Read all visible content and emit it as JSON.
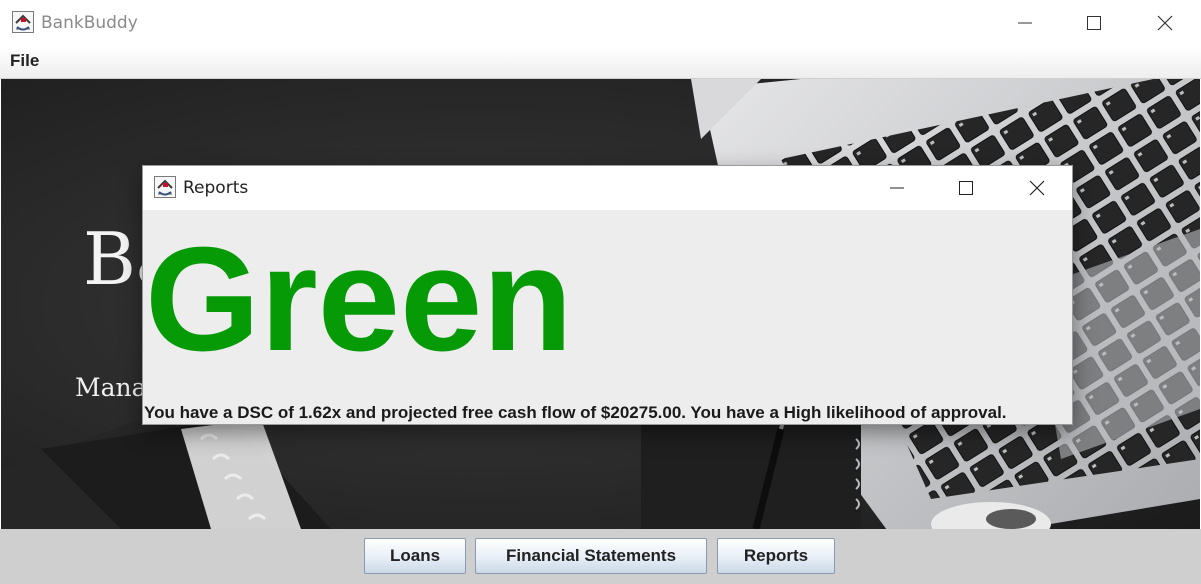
{
  "main_window": {
    "title": "BankBuddy",
    "menu": [
      "File"
    ],
    "hero": {
      "title": "Ba",
      "subtitle": "Mana"
    }
  },
  "bottom_buttons": [
    "Loans",
    "Financial Statements",
    "Reports"
  ],
  "dialog": {
    "title": "Reports",
    "rating": "Green",
    "rating_color": "#079a07",
    "message": "You have a DSC of 1.62x and projected free cash flow of $20275.00. You have a High likelihood of approval."
  },
  "icons": {
    "app": "java-cup-icon",
    "minimize": "minimize-icon",
    "maximize": "maximize-icon",
    "close": "close-icon"
  }
}
